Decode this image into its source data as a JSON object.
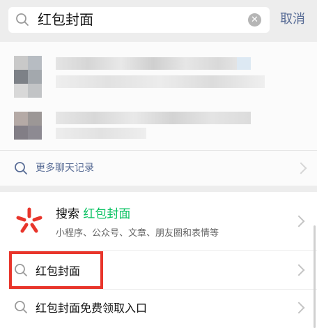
{
  "search": {
    "query": "红包封面",
    "cancel_label": "取消"
  },
  "chat_history": {
    "more_label": "更多聊天记录"
  },
  "search_app": {
    "title_prefix": "搜索",
    "title_highlight": "红包封面",
    "subtitle": "小程序、公众号、文章、朋友圈和表情等"
  },
  "suggestions": [
    {
      "label": "红包封面"
    },
    {
      "label": "红包封面免费领取入口"
    }
  ],
  "colors": {
    "accent_link": "#576b95",
    "highlight_green": "#07c160",
    "annotation_red": "#e8352b",
    "search_logo_red": "#e8352b"
  }
}
